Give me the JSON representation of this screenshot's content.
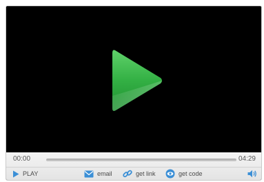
{
  "player": {
    "time_current": "00:00",
    "time_total": "04:29",
    "progress": 0
  },
  "toolbar": {
    "play_label": "PLAY",
    "email_label": "email",
    "link_label": "get link",
    "code_label": "get code"
  },
  "icons": {
    "big_play": "play-icon",
    "play": "play-icon",
    "email": "envelope-icon",
    "link": "chain-link-icon",
    "code": "eye-icon",
    "volume": "speaker-icon"
  },
  "colors": {
    "play_green": "#3cb84a",
    "accent_blue": "#3b8fd6",
    "screen": "#000000"
  }
}
